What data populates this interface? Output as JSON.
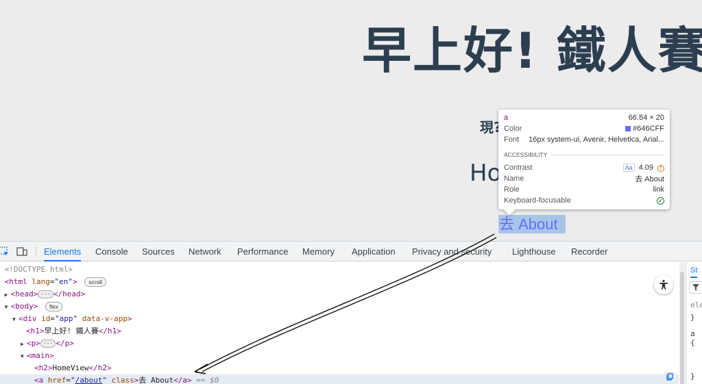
{
  "page": {
    "heading": "早上好! 鐵人賽",
    "paragraph_partial": "現?",
    "h2_partial": "Ho",
    "link_text": "去 About"
  },
  "tooltip": {
    "tag": "a",
    "size": "66.84 × 20",
    "color_label": "Color",
    "color_value": "#646CFF",
    "font_label": "Font",
    "font_value": "16px system-ui, Avenir, Helvetica, Arial...",
    "section": "ACCESSIBILITY",
    "contrast_label": "Contrast",
    "contrast_aa": "Aa",
    "contrast_value": "4.09",
    "name_label": "Name",
    "name_value": "去 About",
    "role_label": "Role",
    "role_value": "link",
    "focus_label": "Keyboard-focusable"
  },
  "devtools": {
    "tabs": [
      "Elements",
      "Console",
      "Sources",
      "Network",
      "Performance",
      "Memory",
      "Application",
      "Privacy and security",
      "Lighthouse",
      "Recorder"
    ],
    "active_tab": "Elements",
    "side_tab": "St",
    "side_lines": [
      "ele",
      "}",
      "a {",
      "}"
    ]
  },
  "dom": {
    "doctype": "<!DOCTYPE html>",
    "html_tag": "<html",
    "html_attr": "lang",
    "html_val": "\"en\"",
    "html_close": ">",
    "scroll_badge": "scroll",
    "head_open": "<head>",
    "head_close": "</head>",
    "body_open": "<body>",
    "flex_badge": "flex",
    "div_open": "<div",
    "div_id": "id",
    "div_id_val": "\"app\"",
    "div_attr2": "data-v-app",
    "div_close": ">",
    "h1_open": "<h1>",
    "h1_text": "早上好! 鐵人賽",
    "h1_close": "</h1>",
    "p_open": "<p>",
    "p_close": "</p>",
    "main_open": "<main>",
    "h2_open": "<h2>",
    "h2_text": "HomeView",
    "h2_close": "</h2>",
    "a_open": "<a",
    "a_href": "href",
    "a_href_val": "/about",
    "a_class": "class",
    "a_gt": ">",
    "a_text": "去 About",
    "a_close": "</a>",
    "a_marker": "== $0",
    "dots": "···"
  }
}
